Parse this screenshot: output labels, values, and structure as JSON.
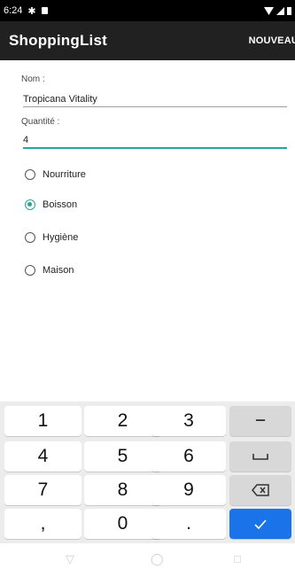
{
  "status_bar": {
    "time": "6:24",
    "icons": [
      "gear-icon",
      "sd-card-icon",
      "wifi-icon",
      "signal-icon",
      "battery-icon"
    ]
  },
  "app_bar": {
    "title": "ShoppingList",
    "action_label": "NOUVEAU"
  },
  "form": {
    "name_label": "Nom :",
    "name_value": "Tropicana Vitality",
    "quantity_label": "Quantité :",
    "quantity_value": "4"
  },
  "categories": [
    {
      "label": "Nourriture",
      "checked": false
    },
    {
      "label": "Boisson",
      "checked": true
    },
    {
      "label": "Hygiène",
      "checked": false
    },
    {
      "label": "Maison",
      "checked": false
    }
  ],
  "keyboard": {
    "rows": [
      [
        "1",
        "2",
        "3",
        "−"
      ],
      [
        "4",
        "5",
        "6",
        "space"
      ],
      [
        "7",
        "8",
        "9",
        "backspace"
      ],
      [
        ",",
        "0",
        ".",
        "enter"
      ]
    ]
  },
  "colors": {
    "accent": "#26a69a",
    "app_bar": "#212121",
    "enter_key": "#1a73e8"
  }
}
